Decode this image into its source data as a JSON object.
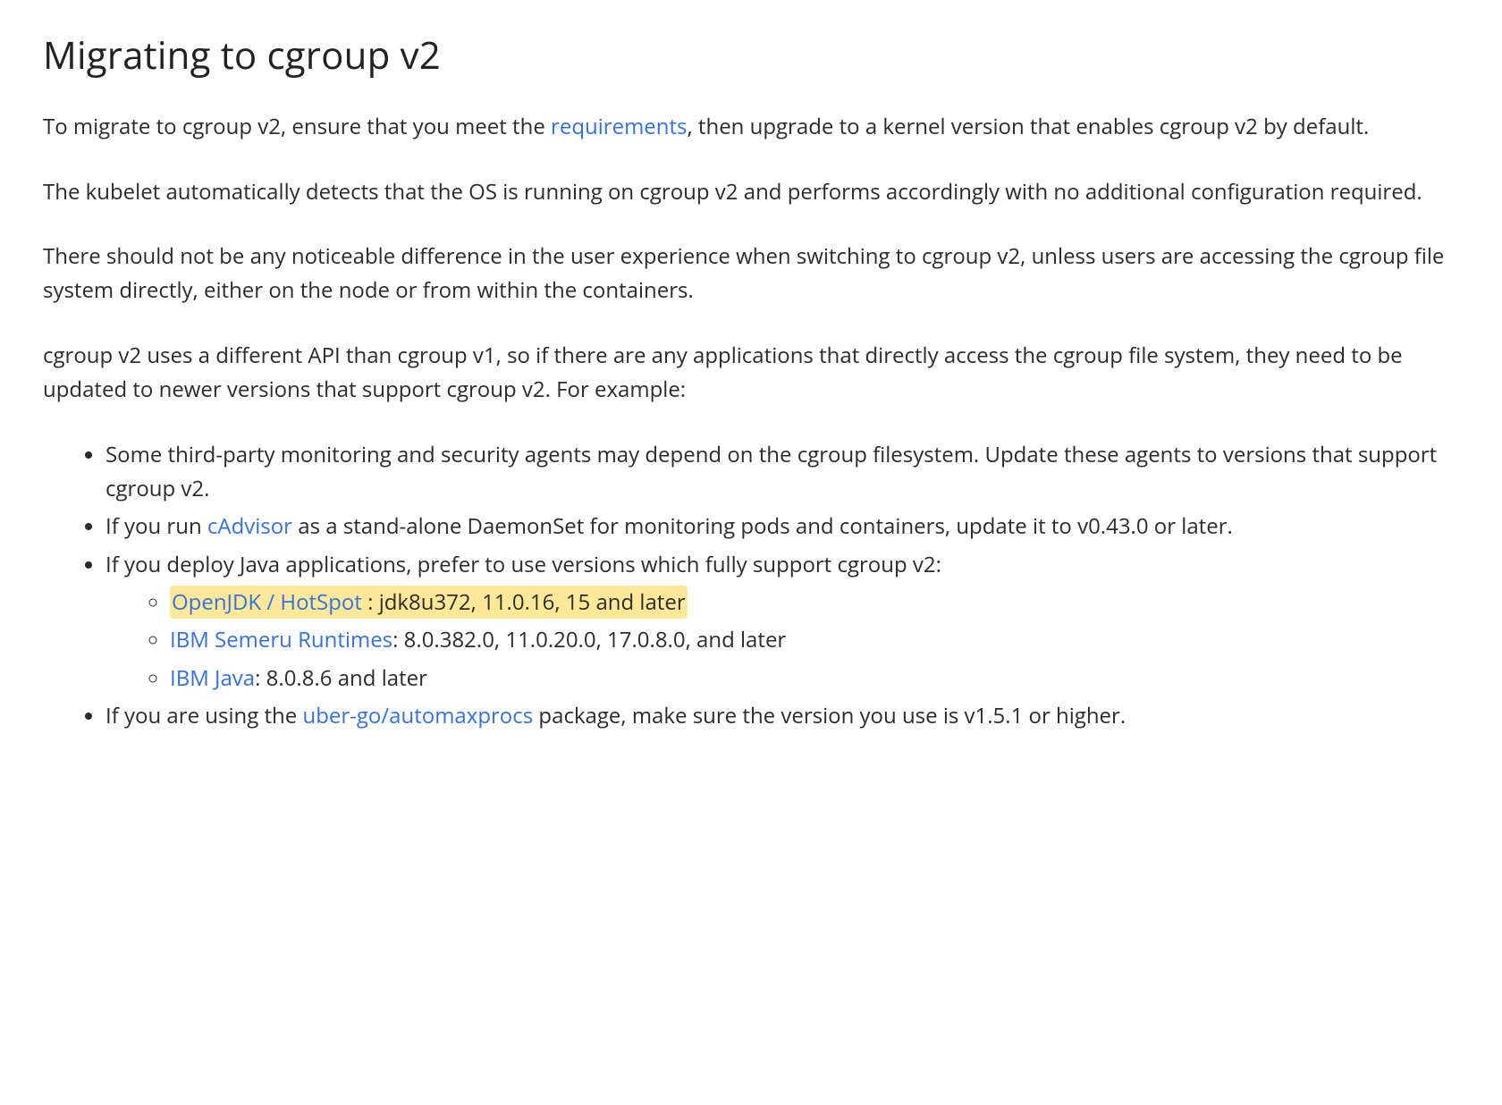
{
  "heading": "Migrating to cgroup v2",
  "p1_a": "To migrate to cgroup v2, ensure that you meet the ",
  "p1_link": "requirements",
  "p1_b": ", then upgrade to a kernel version that enables cgroup v2 by default.",
  "p2": "The kubelet automatically detects that the OS is running on cgroup v2 and performs accordingly with no additional configuration required.",
  "p3": "There should not be any noticeable difference in the user experience when switching to cgroup v2, unless users are accessing the cgroup file system directly, either on the node or from within the containers.",
  "p4": "cgroup v2 uses a different API than cgroup v1, so if there are any applications that directly access the cgroup file system, they need to be updated to newer versions that support cgroup v2. For example:",
  "li1": "Some third-party monitoring and security agents may depend on the cgroup filesystem. Update these agents to versions that support cgroup v2.",
  "li2_a": "If you run ",
  "li2_link": "cAdvisor",
  "li2_b": " as a stand-alone DaemonSet for monitoring pods and containers, update it to v0.43.0 or later.",
  "li3": "If you deploy Java applications, prefer to use versions which fully support cgroup v2:",
  "li3a_link": "OpenJDK / HotSpot",
  "li3a_sep": " : ",
  "li3a_rest": "jdk8u372, 11.0.16, 15 and later",
  "li3b_link": "IBM Semeru Runtimes",
  "li3b_rest": ": 8.0.382.0, 11.0.20.0, 17.0.8.0, and later",
  "li3c_link": "IBM Java",
  "li3c_rest": ": 8.0.8.6 and later",
  "li4_a": "If you are using the ",
  "li4_link": "uber-go/automaxprocs",
  "li4_b": " package, make sure the version you use is v1.5.1 or higher."
}
